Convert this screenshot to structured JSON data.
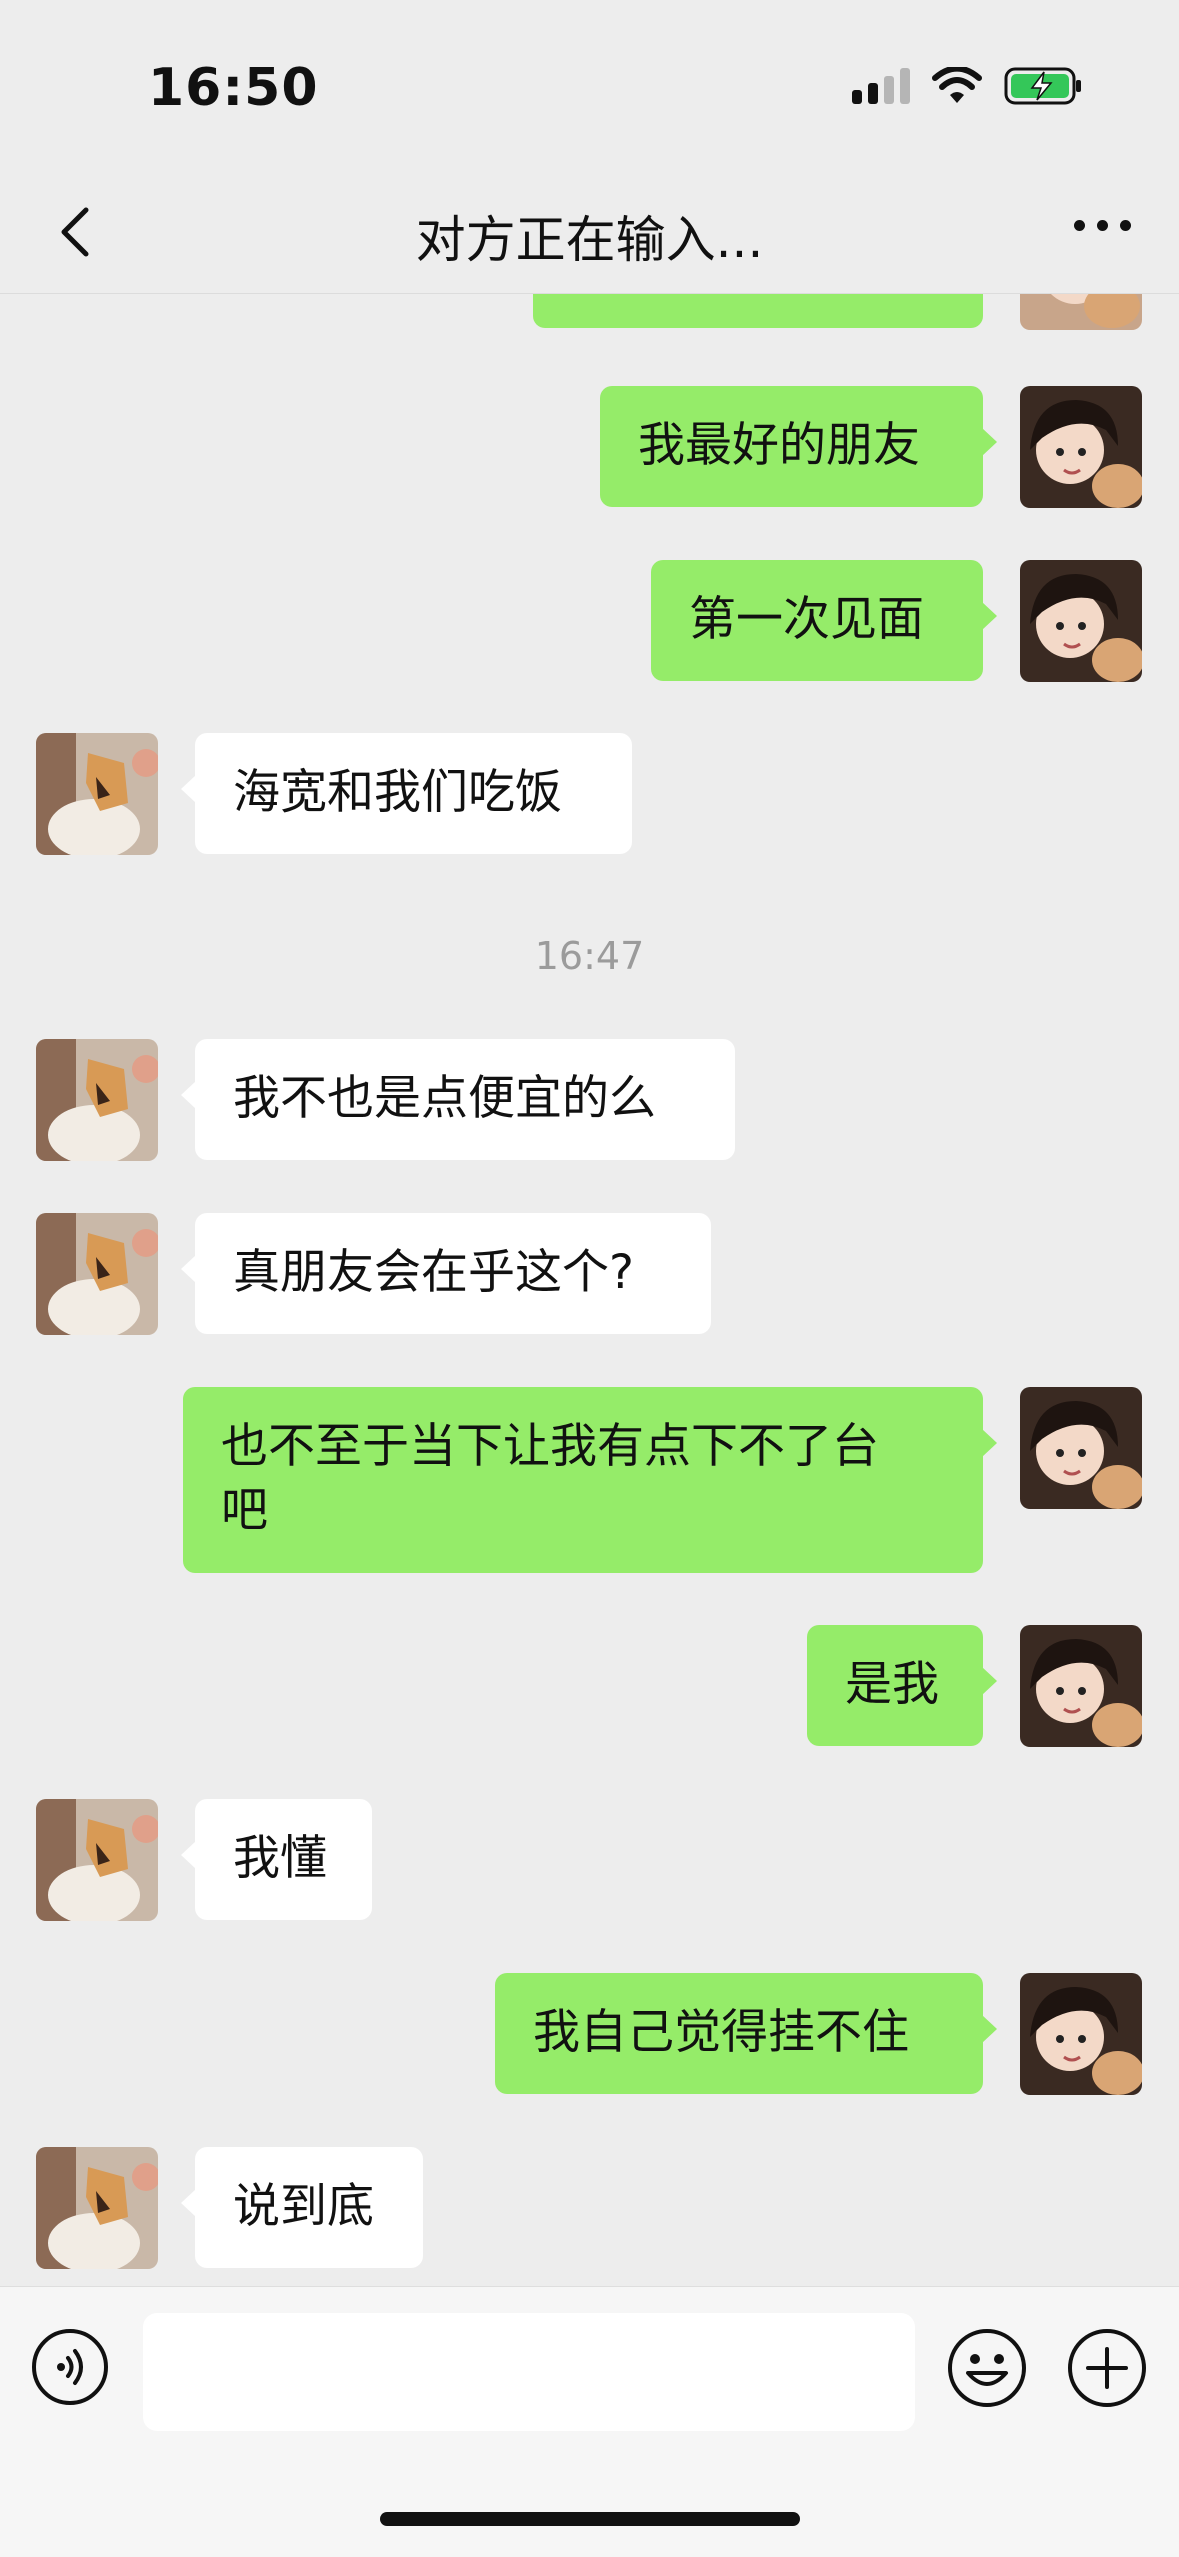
{
  "status_bar": {
    "time": "16:50"
  },
  "nav": {
    "title": "对方正在输入..."
  },
  "messages": [
    {
      "from": "me",
      "text": "我最好的朋友"
    },
    {
      "from": "me",
      "text": "第一次见面"
    },
    {
      "from": "them",
      "text": "海宽和我们吃饭"
    },
    {
      "type": "timestamp",
      "text": "16:47"
    },
    {
      "from": "them",
      "text": "我不也是点便宜的么"
    },
    {
      "from": "them",
      "text": "真朋友会在乎这个?"
    },
    {
      "from": "me",
      "text": "也不至于当下让我有点下不了台\n吧"
    },
    {
      "from": "me",
      "text": "是我"
    },
    {
      "from": "them",
      "text": "我懂"
    },
    {
      "from": "me",
      "text": "我自己觉得挂不住"
    },
    {
      "from": "them",
      "text": "说到底"
    }
  ],
  "input": {
    "value": "",
    "placeholder": ""
  },
  "colors": {
    "my_bubble": "#95ec69",
    "their_bubble": "#ffffff",
    "background": "#ededed"
  },
  "icons": [
    "back-icon",
    "more-icon",
    "voice-icon",
    "emoji-icon",
    "plus-icon",
    "signal-icon",
    "wifi-icon",
    "battery-charging-icon"
  ]
}
